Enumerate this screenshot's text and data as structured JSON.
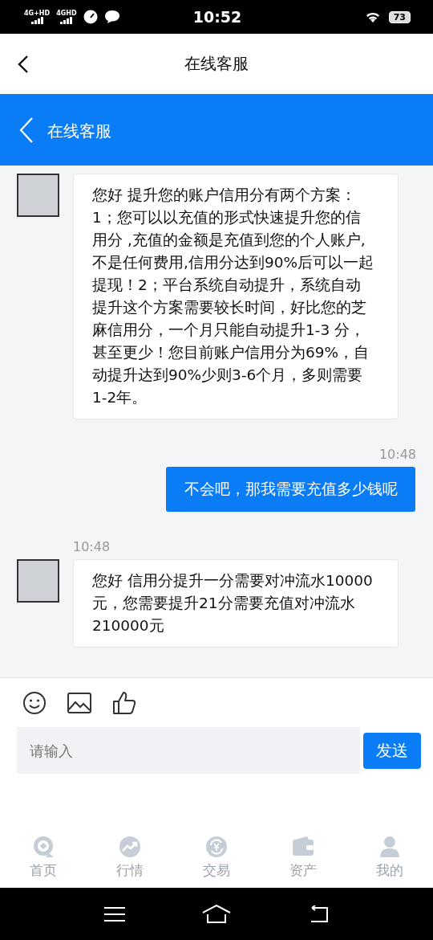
{
  "status_bar": {
    "signals": [
      "4G+HD",
      "4GHD"
    ],
    "time": "10:52",
    "battery": "73"
  },
  "header": {
    "title": "在线客服"
  },
  "blue_bar": {
    "title": "在线客服"
  },
  "messages": [
    {
      "kind": "received",
      "text": "您好 提升您的账户信用分有两个方案：1；您可以以充值的形式快速提升您的信用分 ,充值的金额是充值到您的个人账户,不是任何费用,信用分达到90%后可以一起提现！2；平台系统自动提升，系统自动提升这个方案需要较长时间，好比您的芝麻信用分，一个月只能自动提升1-3 分，甚至更少！您目前账户信用分为69%，自动提升达到90%少则3-6个月，多则需要1-2年。"
    },
    {
      "kind": "sent",
      "time": "10:48",
      "text": "不会吧，那我需要充值多少钱呢"
    },
    {
      "kind": "received",
      "time": "10:48",
      "text": "您好 信用分提升一分需要对冲流水10000元，您需要提升21分需要充值对冲流水210000元"
    }
  ],
  "composer": {
    "placeholder": "请输入",
    "send": "发送"
  },
  "tabs": [
    {
      "label": "首页",
      "selected": false
    },
    {
      "label": "行情",
      "selected": false
    },
    {
      "label": "交易",
      "selected": false
    },
    {
      "label": "资产",
      "selected": false
    },
    {
      "label": "我的",
      "selected": false
    }
  ]
}
